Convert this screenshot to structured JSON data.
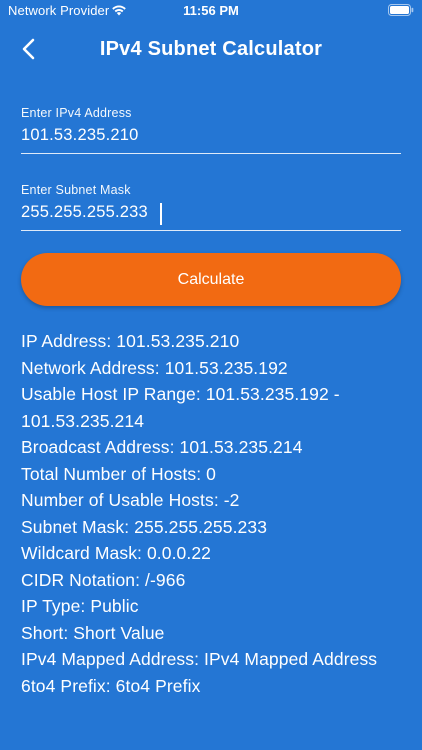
{
  "status_bar": {
    "carrier": "Network Provider",
    "time": "11:56 PM",
    "wifi_icon": "wifi-icon",
    "battery_icon": "battery-icon"
  },
  "header": {
    "title": "IPv4 Subnet Calculator",
    "back_icon": "chevron-left-icon"
  },
  "form": {
    "ip": {
      "label": "Enter IPv4 Address",
      "value": "101.53.235.210"
    },
    "mask": {
      "label": "Enter Subnet Mask",
      "value": "255.255.255.233"
    },
    "calculate_label": "Calculate"
  },
  "results": [
    "IP Address: 101.53.235.210",
    "Network Address: 101.53.235.192",
    "Usable Host IP Range: 101.53.235.192 - 101.53.235.214",
    "Broadcast Address: 101.53.235.214",
    "Total Number of Hosts: 0",
    "Number of Usable Hosts: -2",
    "Subnet Mask: 255.255.255.233",
    "Wildcard Mask: 0.0.0.22",
    "CIDR Notation: /-966",
    "IP Type: Public",
    "Short: Short Value",
    "IPv4 Mapped Address: IPv4 Mapped Address",
    "6to4 Prefix: 6to4 Prefix"
  ],
  "colors": {
    "background": "#2476d4",
    "button": "#f26a12",
    "text": "#ffffff"
  }
}
